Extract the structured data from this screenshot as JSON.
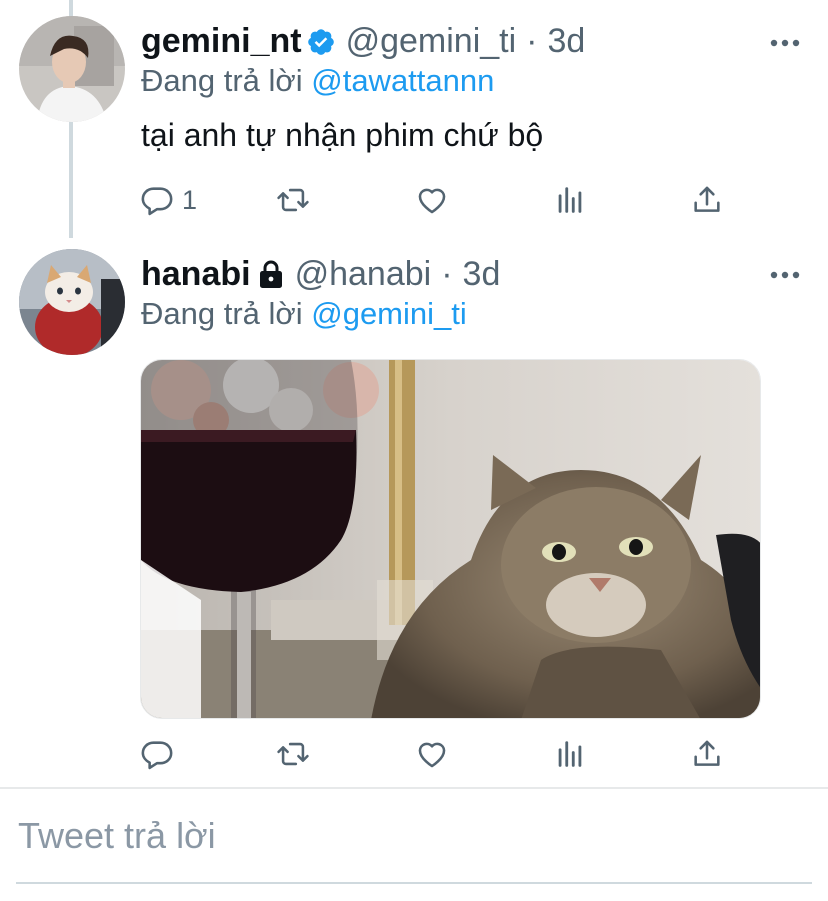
{
  "tweets": [
    {
      "display_name": "gemini_nt",
      "verified": true,
      "handle": "@gemini_ti",
      "separator": "·",
      "time": "3d",
      "reply_prefix": "Đang trả lời ",
      "reply_to": "@tawattannn",
      "text": "tại anh tự nhận phim chứ bộ",
      "reply_count": "1"
    },
    {
      "display_name": "hanabi",
      "protected": true,
      "handle": "@hanabi",
      "separator": "·",
      "time": "3d",
      "reply_prefix": "Đang trả lời ",
      "reply_to": "@gemini_ti",
      "media": "cat-with-wine-glass-photo"
    }
  ],
  "reply_box": {
    "placeholder": "Tweet trả lời"
  },
  "colors": {
    "accent": "#1d9bf0",
    "secondary_text": "#536471",
    "divider": "#e7e9ea"
  }
}
